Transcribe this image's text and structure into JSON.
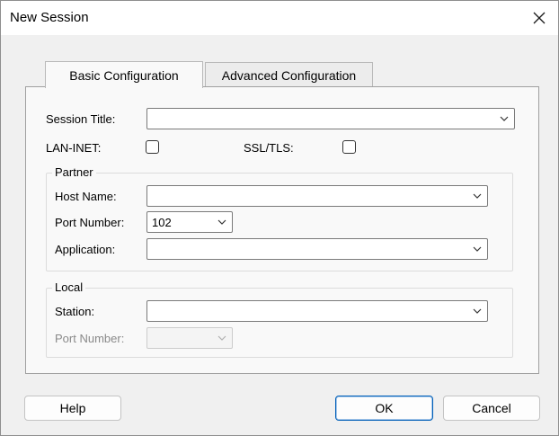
{
  "window": {
    "title": "New Session"
  },
  "icons": {
    "close": "close-icon",
    "dropdown": "chevron-down-icon"
  },
  "tabs": [
    {
      "label": "Basic Configuration",
      "active": true
    },
    {
      "label": "Advanced Configuration",
      "active": false
    }
  ],
  "form": {
    "session_title": {
      "label": "Session Title:",
      "value": ""
    },
    "lan_inet": {
      "label": "LAN-INET:",
      "checked": false
    },
    "ssl_tls": {
      "label": "SSL/TLS:",
      "checked": false
    }
  },
  "partner": {
    "title": "Partner",
    "host_name": {
      "label": "Host Name:",
      "value": ""
    },
    "port_number": {
      "label": "Port Number:",
      "value": "102"
    },
    "application": {
      "label": "Application:",
      "value": ""
    }
  },
  "local": {
    "title": "Local",
    "station": {
      "label": "Station:",
      "value": ""
    },
    "port_number": {
      "label": "Port Number:",
      "value": "",
      "disabled": true
    }
  },
  "buttons": {
    "help": "Help",
    "ok": "OK",
    "cancel": "Cancel"
  },
  "colors": {
    "accent": "#005fb8",
    "titlebar": "#ffffff",
    "dialog_bg": "#f0f0f0"
  }
}
